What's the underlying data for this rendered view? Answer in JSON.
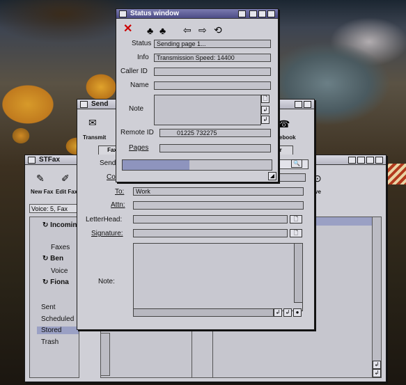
{
  "status_window": {
    "title": "Status window",
    "status_label": "Status",
    "status_value": "Sending page 1...",
    "info_label": "Info",
    "info_value": "Transmission Speed: 14400",
    "caller_id_label": "Caller ID",
    "name_label": "Name",
    "note_label": "Note",
    "remote_id_label": "Remote ID",
    "remote_id_value": "01225 732275",
    "pages_label": "Pages"
  },
  "stfax_window": {
    "title": "STFax",
    "toolbar": {
      "new_fax": "New Fax",
      "edit_fax": "Edit Fax",
      "save": "ve"
    },
    "voice_summary": "Voice: 5, Fax",
    "tree": [
      {
        "label": "Incomin"
      },
      {
        "label": "Faxes"
      },
      {
        "label": "Ben"
      },
      {
        "label": "Voice"
      },
      {
        "label": "Fiona"
      },
      {
        "label": "Sent"
      },
      {
        "label": "Scheduled"
      },
      {
        "label": "Stored"
      },
      {
        "label": "Trash"
      }
    ]
  },
  "send_window": {
    "title": "Send",
    "toolbar": {
      "transmit": "Transmit",
      "phonebook": "ebook",
      "fax_tab": "Fax",
      "other_tab": "er"
    },
    "send_label": "Send",
    "co_label": "Co",
    "to_label": "To:",
    "to_value": "Work",
    "attn_label": "Attn:",
    "letterhead_label": "LetterHead:",
    "signature_label": "Signature:",
    "note_label": "Note:"
  },
  "icons": [
    "close-icon",
    "person-icon",
    "people-icon",
    "arrow-left-icon",
    "arrow-right-icon",
    "refresh-icon",
    "search-icon",
    "page-icon",
    "scroll-up-icon",
    "scroll-down-icon"
  ]
}
